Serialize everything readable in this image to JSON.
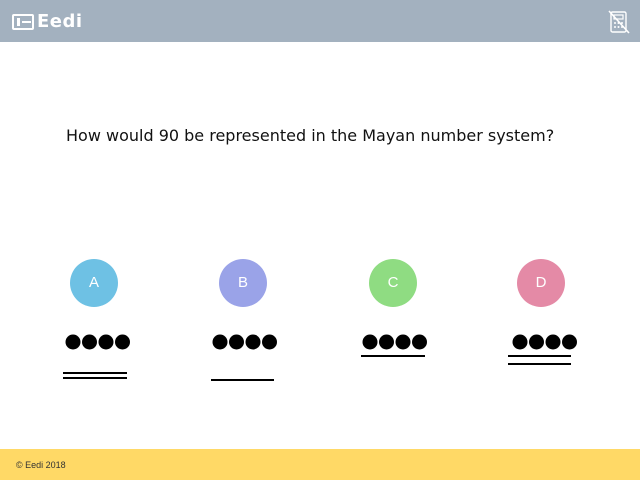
{
  "header": {
    "logo_text": "Eedi",
    "background_color": "#a3b1bf",
    "logo_icon": "eedi-logo-mark",
    "calculator_icon": "calculator-disabled-icon"
  },
  "question": {
    "text": "How would 90 be represented in the Mayan number system?"
  },
  "options": [
    {
      "letter": "A",
      "color": "#6ec1e4",
      "dots": 4,
      "bars": 2
    },
    {
      "letter": "B",
      "color": "#9aa3e8",
      "dots": 4,
      "bars": 1
    },
    {
      "letter": "C",
      "color": "#8fdc82",
      "dots": 4,
      "bars": 1
    },
    {
      "letter": "D",
      "color": "#e48aa6",
      "dots": 4,
      "bars": 2
    }
  ],
  "footer": {
    "text": "© Eedi 2018",
    "background_color": "#ffd966"
  }
}
